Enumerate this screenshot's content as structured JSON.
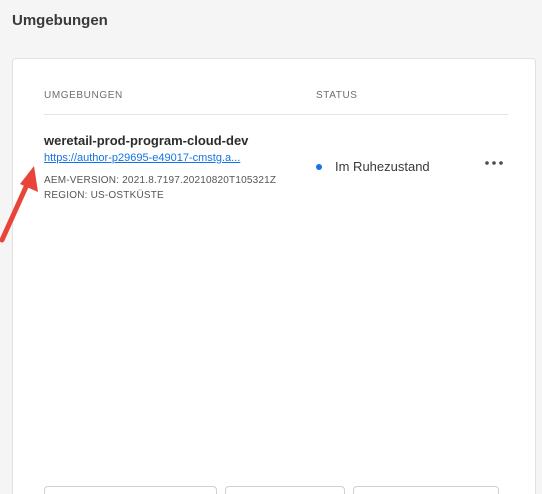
{
  "page": {
    "title": "Umgebungen"
  },
  "table": {
    "headers": {
      "environments": "UMGEBUNGEN",
      "status": "STATUS"
    },
    "rows": [
      {
        "name": "weretail-prod-program-cloud-dev",
        "url": "https://author-p29695-e49017-cmstg.a...",
        "aem_version": "AEM-VERSION: 2021.8.7197.20210820T105321Z",
        "region": "REGION: US-OSTKÜSTE",
        "status": "Im Ruhezustand",
        "status_color": "#1473e6",
        "actions_icon": "more-horizontal-icon"
      }
    ]
  },
  "annotation": {
    "arrow_color": "#e8443a",
    "icon": "arrow-up-right-icon"
  },
  "colors": {
    "link": "#1473e6",
    "card_bg": "#ffffff",
    "page_bg": "#f5f5f5"
  }
}
